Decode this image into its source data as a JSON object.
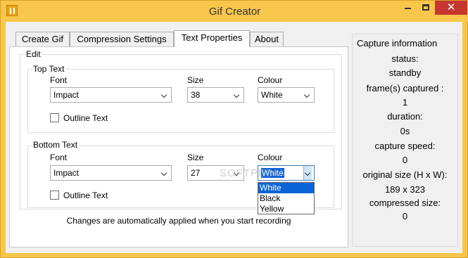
{
  "window": {
    "title": "Gif Creator",
    "close_glyph": "✕"
  },
  "tabs": [
    {
      "label": "Create Gif"
    },
    {
      "label": "Compression Settings"
    },
    {
      "label": "Text Properties",
      "active": true
    },
    {
      "label": "About"
    }
  ],
  "edit": {
    "label": "Edit",
    "top": {
      "label": "Top Text",
      "font_label": "Font",
      "size_label": "Size",
      "colour_label": "Colour",
      "font": "Impact",
      "size": "38",
      "colour": "White",
      "outline_label": "Outline Text",
      "outline_checked": false
    },
    "bottom": {
      "label": "Bottom Text",
      "font_label": "Font",
      "size_label": "Size",
      "colour_label": "Colour",
      "font": "Impact",
      "size": "27",
      "colour": "White",
      "outline_label": "Outline Text",
      "outline_checked": false,
      "colour_options": [
        "White",
        "Black",
        "Yellow"
      ],
      "colour_highlighted": "White"
    }
  },
  "note": "Changes are automatically applied when you start recording",
  "watermark": "SOFTPEDIA",
  "capture": {
    "title": "Capture information",
    "status_label": "status:",
    "status": "standby",
    "frames_label": "frame(s) captured :",
    "frames": "1",
    "duration_label": "duration:",
    "duration": "0s",
    "speed_label": "capture speed:",
    "speed": "0",
    "orig_label": "original size (H x W):",
    "orig": "189 x 323",
    "compressed_label": "compressed size:",
    "compressed": "0"
  },
  "colors": {
    "titlebar": "#f7c64b",
    "close": "#c7372f",
    "selection": "#0a64d7"
  }
}
